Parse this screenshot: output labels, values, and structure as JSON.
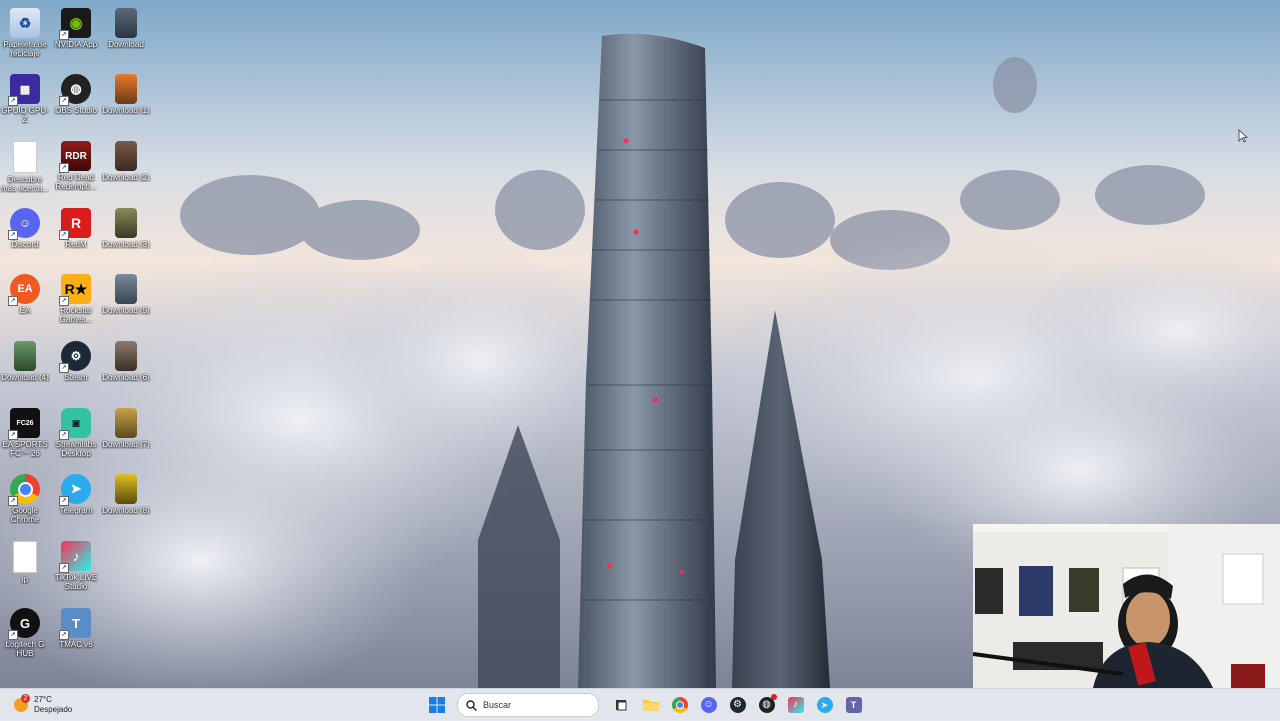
{
  "desktop": {
    "icons": [
      {
        "label": "Papelera de reciclaje",
        "icon": "recycle-bin-icon"
      },
      {
        "label": "NVIDIA App",
        "icon": "nvidia-icon"
      },
      {
        "label": "Download",
        "icon": "image-file-icon"
      },
      {
        "label": "GPUID GPU-Z",
        "icon": "gpuz-icon"
      },
      {
        "label": "OBS Studio",
        "icon": "obs-icon"
      },
      {
        "label": "Download (1)",
        "icon": "image-file-icon"
      },
      {
        "label": "Descubre más acerca...",
        "icon": "blank-file-icon"
      },
      {
        "label": "Red Dead Redempti...",
        "icon": "red-dead-icon"
      },
      {
        "label": "Download (2)",
        "icon": "image-file-icon"
      },
      {
        "label": "Discord",
        "icon": "discord-icon"
      },
      {
        "label": "RedM",
        "icon": "redm-icon"
      },
      {
        "label": "Download (3)",
        "icon": "image-file-icon"
      },
      {
        "label": "EA",
        "icon": "ea-icon"
      },
      {
        "label": "Rockstar Games...",
        "icon": "rockstar-icon"
      },
      {
        "label": "Download (5)",
        "icon": "image-file-icon"
      },
      {
        "label": "Download (4)",
        "icon": "image-file-icon"
      },
      {
        "label": "Steam",
        "icon": "steam-icon"
      },
      {
        "label": "Download (6)",
        "icon": "image-file-icon"
      },
      {
        "label": "EA SPORTS FC™ 26",
        "icon": "easports-icon"
      },
      {
        "label": "Streamlabs Desktop",
        "icon": "streamlabs-icon"
      },
      {
        "label": "Download (7)",
        "icon": "image-file-icon"
      },
      {
        "label": "Google Chrome",
        "icon": "chrome-icon"
      },
      {
        "label": "Telegram",
        "icon": "telegram-icon"
      },
      {
        "label": "Download (8)",
        "icon": "image-file-icon"
      },
      {
        "label": "ip",
        "icon": "text-file-icon"
      },
      {
        "label": "TikTok LIVE Studio",
        "icon": "tiktok-icon"
      },
      {
        "label": "Logitech G HUB",
        "icon": "logitech-icon"
      },
      {
        "label": "TMAC v6",
        "icon": "tmac-icon"
      }
    ]
  },
  "taskbar": {
    "weather_temp": "27°C",
    "weather_desc": "Despejado",
    "weather_badge": "2",
    "search_placeholder": "Buscar"
  }
}
